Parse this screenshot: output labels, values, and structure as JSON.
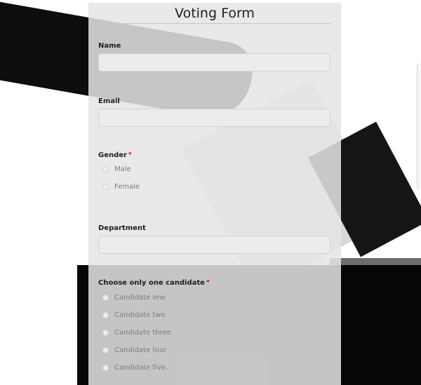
{
  "form": {
    "title": "Voting Form",
    "fields": {
      "name": {
        "label": "Name",
        "value": "",
        "required": false
      },
      "email": {
        "label": "Email",
        "value": "",
        "required": false
      },
      "gender": {
        "label": "Gender",
        "required_mark": "*",
        "options": [
          "Male",
          "Female"
        ]
      },
      "department": {
        "label": "Department",
        "value": ""
      },
      "candidate": {
        "label": "Choose only one candidate",
        "required_mark": "*",
        "options": [
          "Candidate one",
          "Candidate two",
          "Candidate three",
          "Candidate four",
          "Candidate five."
        ]
      }
    }
  },
  "colors": {
    "required": "#d0021b",
    "card_background": "#e5e5e5",
    "label_text": "#1f1f1f",
    "option_text": "#7d7d7d"
  }
}
